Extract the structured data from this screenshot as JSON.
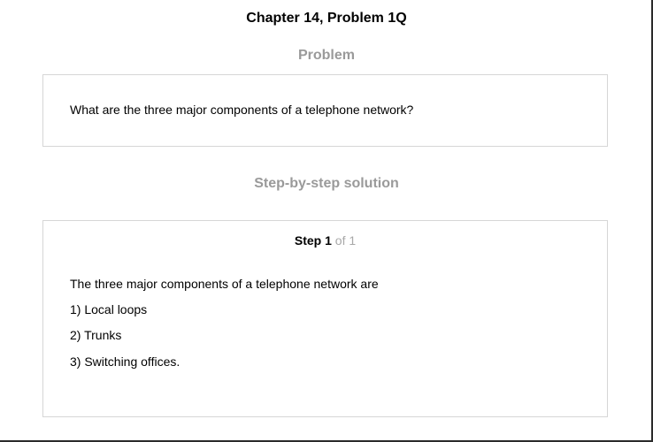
{
  "header": {
    "title": "Chapter 14, Problem 1Q"
  },
  "problem": {
    "heading": "Problem",
    "text": "What are the three major components of a telephone network?"
  },
  "solution": {
    "heading": "Step-by-step solution",
    "step": {
      "label": "Step",
      "number": "1",
      "of_text": "of 1"
    },
    "lines": [
      "The three major components of a telephone network are",
      "1) Local loops",
      "2) Trunks",
      "3) Switching offices."
    ]
  }
}
